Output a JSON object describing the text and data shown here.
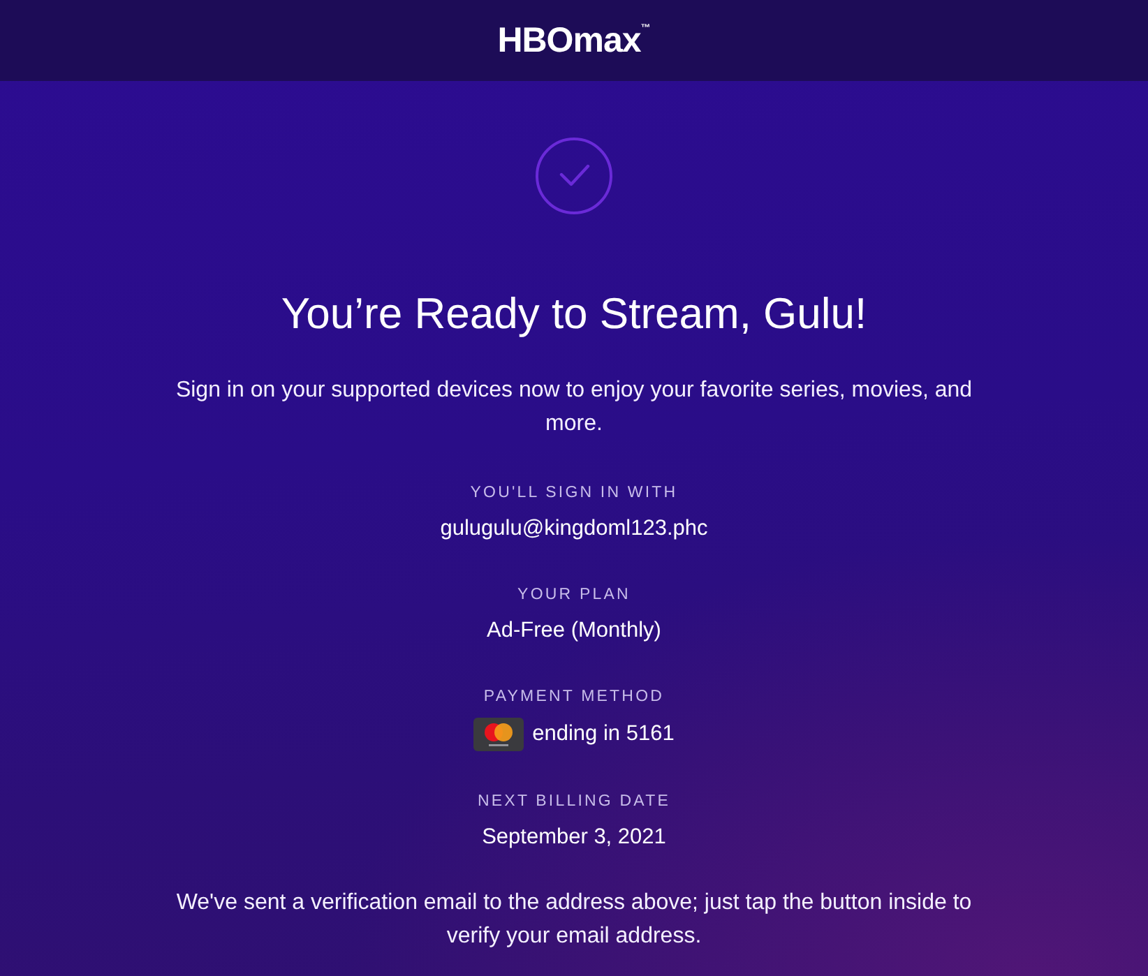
{
  "header": {
    "logo": "HBOmax$^{™}$"
  },
  "confirmation": {
    "title": "You’re Ready to Stream, Gulu!",
    "message": "Sign in on your supported devices now to enjoy your favorite series, movies, and more."
  },
  "details": [
    {
      "kind": "text",
      "label": "YOU'LL SIGN IN WITH",
      "value": "gulugulu@kingdoml123.phc"
    },
    {
      "kind": "text",
      "label": "YOUR PLAN",
      "value": "Ad-Free (Monthly)"
    },
    {
      "kind": "card",
      "label": "PAYMENT METHOD",
      "value": "ending in 5161"
    },
    {
      "kind": "text",
      "label": "NEXT BILLING DATE",
      "value": "September 3, 2021"
    }
  ],
  "footer_note": "We've sent a verification email to the address above; just tap the button inside to verify your email address."
}
